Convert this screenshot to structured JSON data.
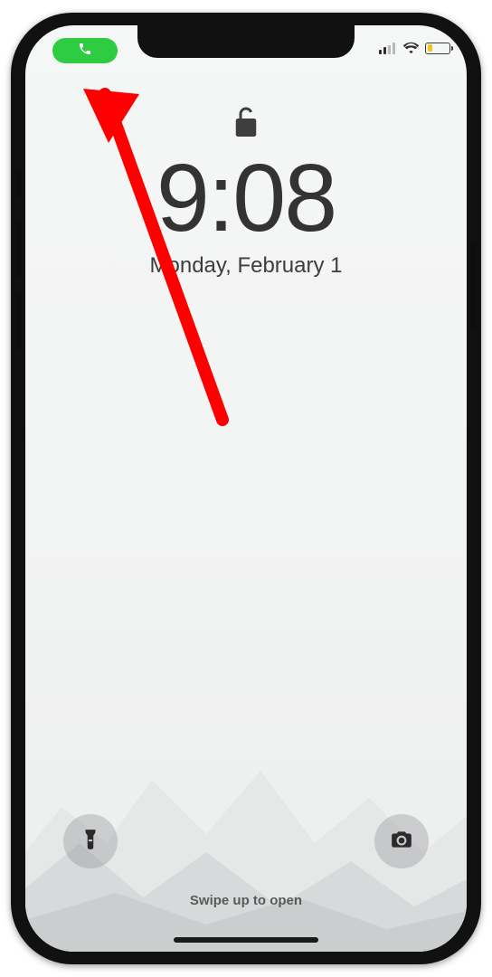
{
  "status": {
    "call_pill_icon": "phone-icon",
    "call_pill_color": "#2ecc40",
    "signal_bars": 2,
    "wifi": true,
    "battery_percent": 20,
    "battery_color": "#f5c518"
  },
  "lockscreen": {
    "lock_state": "unlocked",
    "time": "9:08",
    "date": "Monday, February 1",
    "swipe_hint": "Swipe up to open"
  },
  "buttons": {
    "flashlight": "flashlight-icon",
    "camera": "camera-icon"
  },
  "annotation": {
    "arrow_color": "#ff0000",
    "target": "call-pill"
  }
}
